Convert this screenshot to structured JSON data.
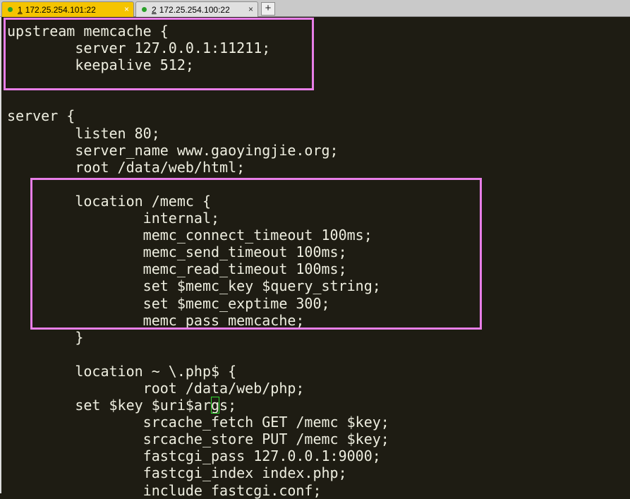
{
  "tabs": [
    {
      "num": "1",
      "host": "172.25.254.101:22",
      "close": "×",
      "active": true
    },
    {
      "num": "2",
      "host": "172.25.254.100:22",
      "close": "×",
      "active": false
    }
  ],
  "add_tab_label": "+",
  "colors": {
    "active_tab": "#f5c400",
    "status_dot": "#2aa02a",
    "terminal_bg": "#1e1c13",
    "terminal_fg": "#eeeee0",
    "highlight_box": "#e87ee8",
    "cursor": "#2fd82f"
  },
  "cursor_line": {
    "before": "        set $key $uri$ar",
    "cursor_char": "g",
    "after": "s;"
  },
  "lines": [
    "upstream memcache {",
    "        server 127.0.0.1:11211;",
    "        keepalive 512;",
    "",
    "",
    "server {",
    "        listen 80;",
    "        server_name www.gaoyingjie.org;",
    "        root /data/web/html;",
    "",
    "        location /memc {",
    "                internal;",
    "                memc_connect_timeout 100ms;",
    "                memc_send_timeout 100ms;",
    "                memc_read_timeout 100ms;",
    "                set $memc_key $query_string;",
    "                set $memc_exptime 300;",
    "                memc_pass memcache;",
    "        }",
    "",
    "        location ~ \\.php$ {",
    "                root /data/web/php;",
    "",
    "                srcache_fetch GET /memc $key;",
    "                srcache_store PUT /memc $key;",
    "                fastcgi_pass 127.0.0.1:9000;",
    "                fastcgi_index index.php;",
    "                include fastcgi.conf;"
  ]
}
